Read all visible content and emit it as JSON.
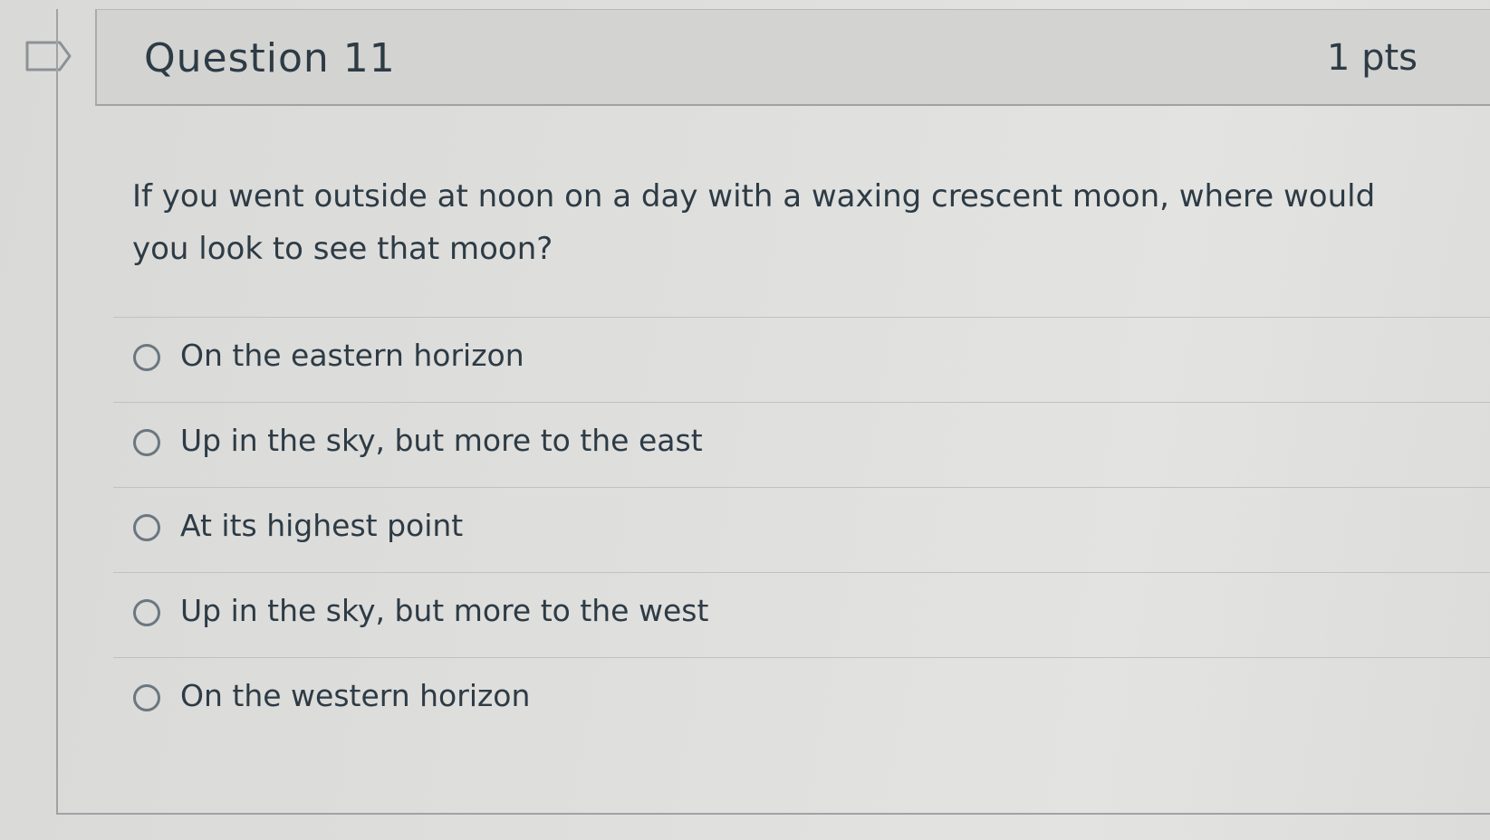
{
  "question": {
    "title": "Question 11",
    "points": "1 pts",
    "text": "If you went outside at noon on a day with a waxing crescent moon, where would you look to see that moon?"
  },
  "answers": [
    {
      "label": "On the eastern horizon",
      "selected": false
    },
    {
      "label": "Up in the sky, but more to the east",
      "selected": false
    },
    {
      "label": "At its highest point",
      "selected": false
    },
    {
      "label": "Up in the sky, but more to the west",
      "selected": false
    },
    {
      "label": "On the western horizon",
      "selected": false
    }
  ],
  "icons": {
    "flag": "flag-icon",
    "radio": "radio-unchecked-icon"
  },
  "colors": {
    "text": "#2d3b45",
    "header_background": "#d3d3d1",
    "divider": "#bfc2c4"
  }
}
